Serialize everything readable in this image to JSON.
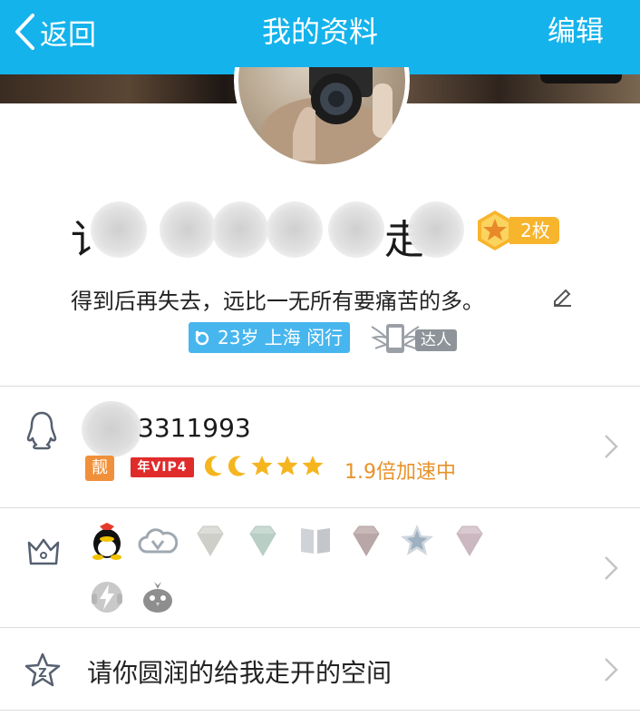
{
  "header": {
    "back_label": "返回",
    "title": "我的资料",
    "edit_label": "编辑",
    "background_color": "#14b3ec"
  },
  "profile": {
    "name_visible_start": "讠",
    "name_visible_end": "走",
    "medal_count": "2枚",
    "signature": "得到后再失去，远比一无所有要痛苦的多。",
    "location_tag": "23岁 上海 闵行",
    "daren_label": "达人"
  },
  "qq_row": {
    "number": "3311993",
    "liang_badge": "靓",
    "vip_badge": "年VIP4",
    "speed_text": "1.9倍加速中",
    "level_icons": [
      "moon-icon",
      "moon-icon",
      "star-icon",
      "star-icon",
      "star-icon"
    ]
  },
  "privilege_row": {
    "icons": [
      "qq-penguin-icon",
      "cloud-v-icon",
      "diamond-icon",
      "green-diamond-icon",
      "book-icon",
      "pink-diamond-icon",
      "star-badge-icon",
      "purple-diamond-icon",
      "lightning-icon",
      "bird-icon"
    ]
  },
  "space_row": {
    "text": "请你圆润的给我走开的空间"
  },
  "colors": {
    "accent": "#14b3ec",
    "location_tag": "#47b6ee",
    "speed_text": "#e8922a",
    "medal": "#f7b42d",
    "vip_red": "#e02b2b"
  }
}
